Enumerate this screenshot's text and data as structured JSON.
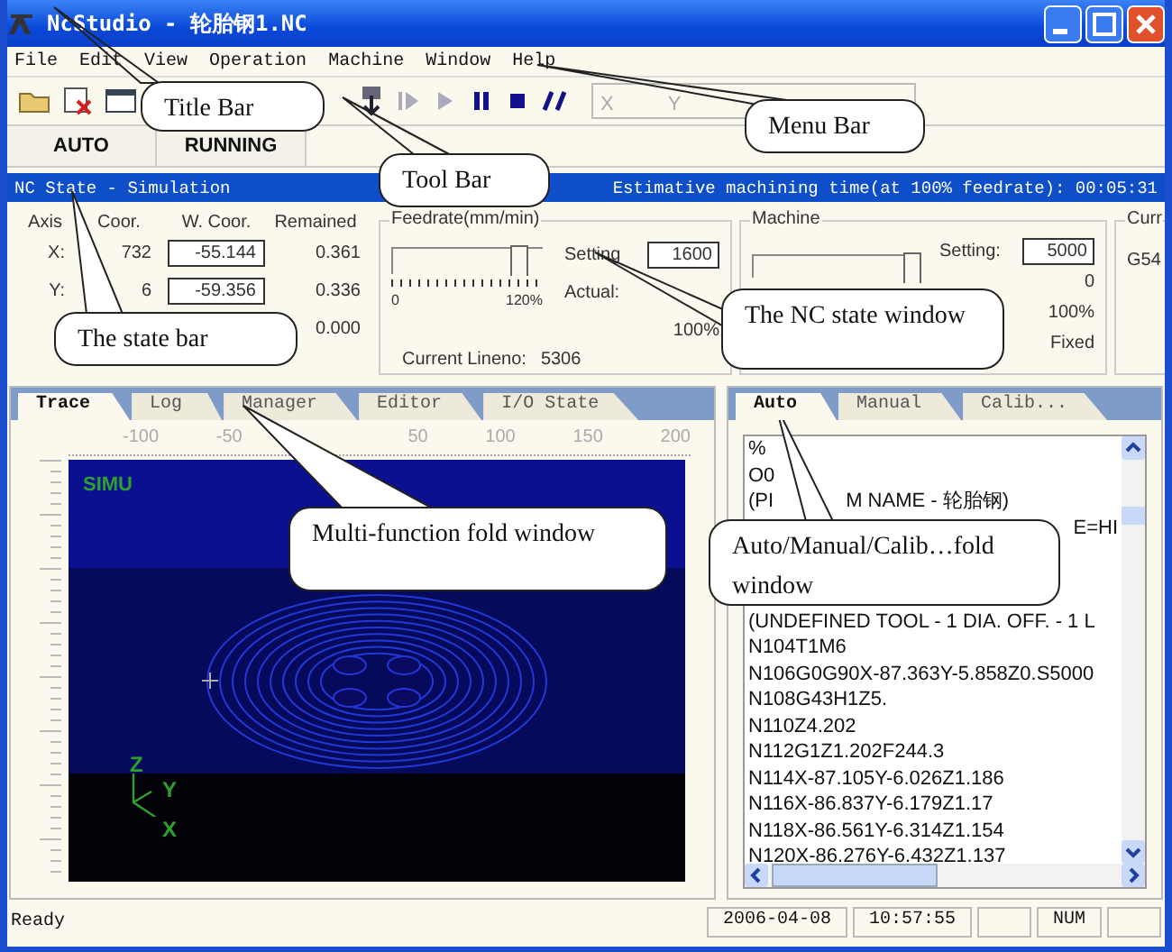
{
  "window": {
    "title": "NcStudio - 轮胎钢1.NC"
  },
  "menu": [
    "File",
    "Edit",
    "View",
    "Operation",
    "Machine",
    "Window",
    "Help"
  ],
  "toolbar": {
    "coord_fields": [
      "X",
      "Y"
    ]
  },
  "mode_row": [
    "AUTO",
    "RUNNING"
  ],
  "state_bar": {
    "title": "NC State - Simulation",
    "machining_time": "Estimative machining time(at 100% feedrate): 00:05:31"
  },
  "axes": {
    "headers": [
      "Axis",
      "Coor.",
      "W. Coor.",
      "Remained"
    ],
    "rows": [
      {
        "axis": "X:",
        "machine": "732",
        "work": "-55.144",
        "remained": "0.361"
      },
      {
        "axis": "Y:",
        "machine": "6",
        "work": "-59.356",
        "remained": "0.336"
      },
      {
        "remained": "0.000"
      }
    ]
  },
  "feedrate": {
    "title": "Feedrate(mm/min)",
    "level": 0.83,
    "scale_min": "0",
    "scale_max": "120%",
    "setting_label": "Setting",
    "setting": "1600",
    "actual_label": "Actual:",
    "override": "100%",
    "lineno_label": "Current Lineno:",
    "lineno": "5306"
  },
  "machine": {
    "title": "Machine",
    "level": 0.95,
    "setting_label": "Setting:",
    "setting": "5000",
    "actual": "0",
    "override": "100%",
    "mode": "Fixed"
  },
  "current": {
    "title": "Curr",
    "coord": "G54"
  },
  "left_panel": {
    "tabs": [
      {
        "label": "Trace",
        "selected": true
      },
      {
        "label": "Log",
        "selected": false
      },
      {
        "label": "Manager",
        "selected": false
      },
      {
        "label": "Editor",
        "selected": false
      },
      {
        "label": "I/O State",
        "selected": false
      }
    ],
    "ruler": [
      "-100",
      "-50",
      "50",
      "100",
      "150",
      "200"
    ],
    "sim_label": "SIMU",
    "axis_labels": [
      "Z",
      "Y",
      "X"
    ]
  },
  "right_panel": {
    "tabs": [
      {
        "label": "Auto",
        "selected": true
      },
      {
        "label": "Manual",
        "selected": false
      },
      {
        "label": "Calib...",
        "selected": false
      }
    ],
    "code_lines": [
      {
        "kind": "plain",
        "text": "%"
      },
      {
        "kind": "plain",
        "text": "O0"
      },
      {
        "kind": "split",
        "parts": [
          "(PI",
          "M NAME - 轮胎钢)"
        ]
      },
      {
        "kind": "covered",
        "text": "E=HI"
      },
      {
        "kind": "plain",
        "text": "(UNDEFINED TOOL - 1 DIA. OFF. - 1 L"
      },
      {
        "kind": "plain",
        "text": "N104T1M6"
      },
      {
        "kind": "plain",
        "text": "N106G0G90X-87.363Y-5.858Z0.S5000"
      },
      {
        "kind": "plain",
        "text": "N108G43H1Z5."
      },
      {
        "kind": "plain",
        "text": "N110Z4.202"
      },
      {
        "kind": "plain",
        "text": "N112G1Z1.202F244.3"
      },
      {
        "kind": "plain",
        "text": "N114X-87.105Y-6.026Z1.186"
      },
      {
        "kind": "plain",
        "text": "N116X-86.837Y-6.179Z1.17"
      },
      {
        "kind": "plain",
        "text": "N118X-86.561Y-6.314Z1.154"
      },
      {
        "kind": "plain",
        "text": "N120X-86.276Y-6.432Z1.137"
      }
    ]
  },
  "status_bar": {
    "message": "Ready",
    "date": "2006-04-08",
    "time": "10:57:55",
    "num": "NUM"
  },
  "callouts": [
    "Title Bar",
    "Menu Bar",
    "Tool Bar",
    "The state bar",
    "The NC state window",
    "Multi-function fold window",
    "Auto/Manual/Calib…fold window"
  ]
}
